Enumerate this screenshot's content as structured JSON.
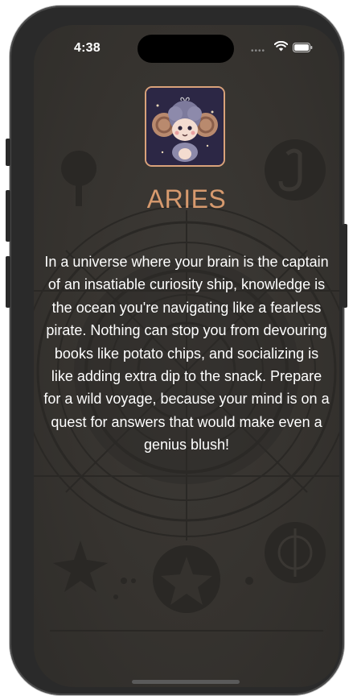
{
  "status_bar": {
    "time": "4:38",
    "signal_icon": "cellular-dots-icon",
    "wifi_icon": "wifi-icon",
    "battery_icon": "battery-icon"
  },
  "header": {
    "avatar_icon": "aries-ram-avatar-icon",
    "title": "ARIES"
  },
  "content": {
    "reading": "In a universe where your brain is the captain of an insatiable curiosity ship, knowledge is the ocean you're navigating like a fearless pirate. Nothing can stop you from devouring books like potato chips, and socializing is like adding extra dip to the snack. Prepare for a wild voyage, because your mind is on a quest for answers that would make even a genius blush!"
  },
  "colors": {
    "title": "#d79a6e",
    "avatar_border": "#d9a27a",
    "background": "#36332f",
    "text": "#ffffff"
  }
}
